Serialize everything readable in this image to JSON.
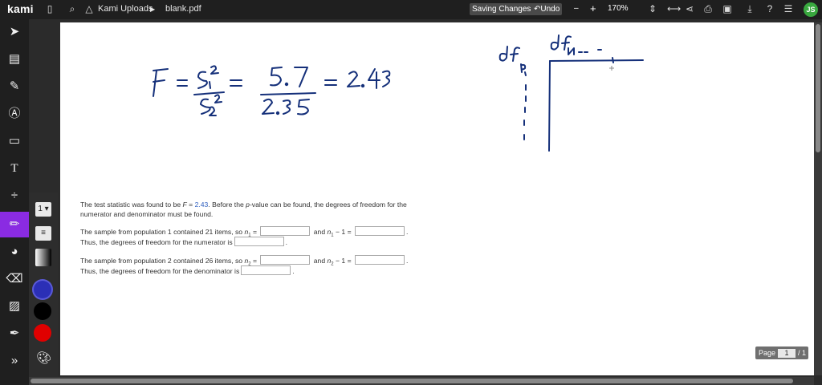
{
  "topbar": {
    "logo": "kami",
    "folder": "Kami Uploads",
    "file": "blank.pdf",
    "saving": "Saving Changes...",
    "undo": "Undo",
    "zoom_minus": "–",
    "zoom_plus": "+",
    "zoom": "170%",
    "avatar": "JS"
  },
  "tools": [
    "select-arrow",
    "book",
    "text-highlight",
    "markup",
    "comment",
    "text",
    "divide",
    "draw",
    "shapes",
    "eraser",
    "add-media",
    "signature",
    "collapse"
  ],
  "flyout": {
    "size": "1 ▾",
    "swatches": [
      "#2b2fb6",
      "#000000",
      "#e00000"
    ]
  },
  "handwriting": {
    "F": "F",
    "eq1": "=",
    "num": "s₁²",
    "den": "s₂²",
    "eq2": "=",
    "val_num": "5.7",
    "val_den": "2.35",
    "eq3": "=",
    "result": "2.43",
    "df_d": "df D",
    "df_n": "df N -- -"
  },
  "question": {
    "p1a": "The test statistic was found to be ",
    "p1F": "F",
    "p1eq": " = ",
    "p1val": "2.43",
    "p1b": ". Before the ",
    "p1p": "p",
    "p1c": "-value can be found, the degrees of freedom for the",
    "p1d": "numerator and denominator must be found.",
    "p2a": "The sample from population 1 contained 21 items, so ",
    "n1": "n",
    "sub1": "1",
    "eqs": " = ",
    "and": " and ",
    "minus1": " − 1 = ",
    "dot": ".",
    "p2b": "Thus, the degrees of freedom for the numerator is",
    "p3a": "The sample from population 2 contained 26 items, so ",
    "sub2": "2",
    "p3b": "Thus, the degrees of freedom for the denominator is"
  },
  "page": {
    "label": "Page",
    "current": "1",
    "total": "/ 1"
  }
}
